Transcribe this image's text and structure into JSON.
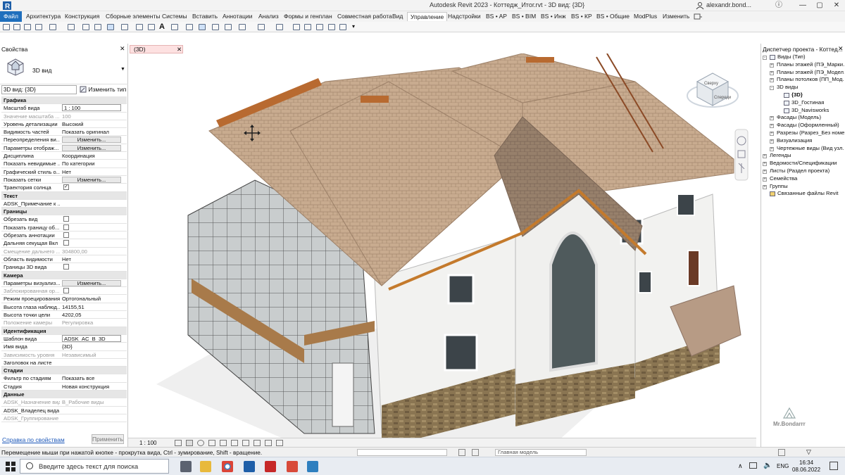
{
  "app": {
    "title": "Autodesk Revit 2023 - Коттедж_Итог.rvt - 3D вид: {3D}",
    "user": "alexandr.bond..."
  },
  "ribbon": {
    "tabs": [
      "Файл",
      "Архитектура",
      "Конструкция",
      "Сборные элементы",
      "Системы",
      "Вставить",
      "Аннотации",
      "Анализ",
      "Формы и генплан",
      "Совместная работа",
      "Вид",
      "Управление",
      "Надстройки",
      "BS • AP",
      "BS • BIM",
      "BS • Инж",
      "BS • КР",
      "BS • Общие",
      "ModPlus",
      "Изменить"
    ],
    "active_tab": "Управление"
  },
  "properties": {
    "title": "Свойства",
    "close": "✕",
    "type_name": "3D вид",
    "instance_selector": "3D вид: {3D}",
    "edit_type_label": "Изменить тип",
    "rows": [
      {
        "kind": "head",
        "k": "Графика"
      },
      {
        "k": "Масштаб вида",
        "v": "1 : 100",
        "input": true
      },
      {
        "k": "Значение масштаба ...",
        "v": "100",
        "grey": true
      },
      {
        "k": "Уровень детализации",
        "v": "Высокий"
      },
      {
        "k": "Видимость частей",
        "v": "Показать оригинал"
      },
      {
        "k": "Переопределения ви...",
        "btn": "Изменить..."
      },
      {
        "k": "Параметры отображ...",
        "btn": "Изменить..."
      },
      {
        "k": "Дисциплина",
        "v": "Координация"
      },
      {
        "k": "Показать невидимые ...",
        "v": "По категории"
      },
      {
        "k": "Графический стиль о...",
        "v": "Нет"
      },
      {
        "k": "Показать сетки",
        "btn": "Изменить..."
      },
      {
        "k": "Траектория солнца",
        "cb": true
      },
      {
        "kind": "head",
        "k": "Текст"
      },
      {
        "k": "ADSK_Примечание к ...",
        "v": ""
      },
      {
        "kind": "head",
        "k": "Границы"
      },
      {
        "k": "Обрезать вид",
        "cb": false
      },
      {
        "k": "Показать границу об...",
        "cb": false
      },
      {
        "k": "Обрезать аннотации",
        "cb": false
      },
      {
        "k": "Дальняя секущая Вкл",
        "cb": false
      },
      {
        "k": "Смещение дальнего ...",
        "v": "304800,00",
        "grey": true
      },
      {
        "k": "Область видимости",
        "v": "Нет"
      },
      {
        "k": "Границы 3D вида",
        "cb": false
      },
      {
        "kind": "head",
        "k": "Камера"
      },
      {
        "k": "Параметры визуализ...",
        "btn": "Изменить..."
      },
      {
        "k": "Заблокированная ор...",
        "cb": false,
        "grey": true
      },
      {
        "k": "Режим проецирования",
        "v": "Ортогональный"
      },
      {
        "k": "Высота глаза наблюд...",
        "v": "14155,51"
      },
      {
        "k": "Высота точки цели",
        "v": "4202,05"
      },
      {
        "k": "Положение камеры",
        "v": "Регулировка",
        "grey": true
      },
      {
        "kind": "head",
        "k": "Идентификация"
      },
      {
        "k": "Шаблон вида",
        "v": "ADSK_AC_B_3D",
        "input": true
      },
      {
        "k": "Имя вида",
        "v": "{3D}"
      },
      {
        "k": "Зависимость уровня",
        "v": "Независимый",
        "grey": true
      },
      {
        "k": "Заголовок на листе",
        "v": ""
      },
      {
        "kind": "head",
        "k": "Стадии"
      },
      {
        "k": "Фильтр по стадиям",
        "v": "Показать все"
      },
      {
        "k": "Стадия",
        "v": "Новая конструкция"
      },
      {
        "kind": "head",
        "k": "Данные"
      },
      {
        "k": "ADSK_Назначение вида",
        "v": "В_Рабочие виды",
        "grey": true
      },
      {
        "k": "ADSK_Владелец вида",
        "v": ""
      },
      {
        "k": "ADSK_Группирование",
        "v": "",
        "grey": true
      }
    ],
    "help_link": "Справка по свойствам",
    "apply_button": "Применить"
  },
  "view": {
    "tab_label": "(3D)",
    "tab_close": "✕",
    "scale": "1 : 100"
  },
  "browser": {
    "title": "Диспетчер проекта - Коттед...",
    "close": "✕",
    "nodes": [
      {
        "level": 0,
        "exp": "-",
        "label": "Виды (Тип)",
        "icon": "views-icon"
      },
      {
        "level": 1,
        "exp": "+",
        "label": "Планы этажей (ПЭ_Марки..."
      },
      {
        "level": 1,
        "exp": "+",
        "label": "Планы этажей (ПЭ_Модел..."
      },
      {
        "level": 1,
        "exp": "+",
        "label": "Планы потолков (ПП_Мод..."
      },
      {
        "level": 1,
        "exp": "-",
        "label": "3D виды"
      },
      {
        "level": 2,
        "exp": "",
        "label": "{3D}",
        "bold": true
      },
      {
        "level": 2,
        "exp": "",
        "label": "3D_Гостиная"
      },
      {
        "level": 2,
        "exp": "",
        "label": "3D_Navisworks"
      },
      {
        "level": 1,
        "exp": "+",
        "label": "Фасады (Модель)"
      },
      {
        "level": 1,
        "exp": "+",
        "label": "Фасады (Оформленный)"
      },
      {
        "level": 1,
        "exp": "+",
        "label": "Разрезы (Разрез_Без номе..."
      },
      {
        "level": 1,
        "exp": "+",
        "label": "Визуализация"
      },
      {
        "level": 1,
        "exp": "+",
        "label": "Чертежные виды (Вид узл..."
      },
      {
        "level": 0,
        "exp": "+",
        "label": "Легенды"
      },
      {
        "level": 0,
        "exp": "+",
        "label": "Ведомости/Спецификации"
      },
      {
        "level": 0,
        "exp": "+",
        "label": "Листы (Раздел проекта)"
      },
      {
        "level": 0,
        "exp": "+",
        "label": "Семейства"
      },
      {
        "level": 0,
        "exp": "+",
        "label": "Группы"
      },
      {
        "level": 0,
        "exp": "",
        "label": "Связанные файлы Revit",
        "icon": "link-icon"
      }
    ],
    "watermark": "Mr.Bondarrr"
  },
  "viewcube": {
    "top_label": "Сверху",
    "front_label": "Спереди"
  },
  "status": {
    "message": "Перемещение мыши при нажатой кнопке - прокрутка вида, Ctrl - зумирование, Shift - вращение.",
    "model_selector": "Главная модель"
  },
  "taskbar": {
    "search_placeholder": "Введите здесь текст для поиска",
    "language": "ENG",
    "time": "16:34",
    "date": "08.06.2022"
  },
  "colors": {
    "accent": "#1f6fbd",
    "roof": "#c8ab8f",
    "roof_dark": "#9c8068",
    "wall": "#f2f2f0",
    "stone": "#8a7552",
    "trim": "#c47a2c"
  }
}
